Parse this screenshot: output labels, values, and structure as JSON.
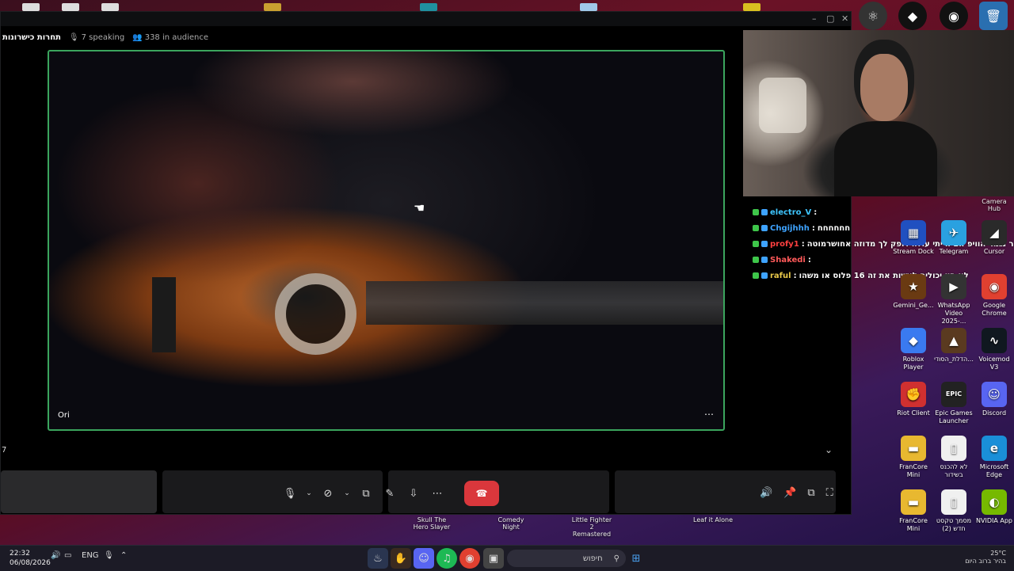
{
  "stage": {
    "title": "תחרות כישרונות",
    "speaking": "7 speaking",
    "audience": "338 in audience",
    "participant_name": "Ori",
    "participant_count": "7"
  },
  "chat": [
    {
      "user": "electro_V",
      "sep": ":",
      "msg": "",
      "color": "#3ec6ff"
    },
    {
      "user": "Chgijhhh",
      "sep": ":",
      "msg": "חחחחחח",
      "color": "#3ea3ff"
    },
    {
      "user": "profy1",
      "sep": ":",
      "msg": "ר נגמר הוויפ אם הייתי עולה דופק לך מדוזה אחושרמוטה",
      "color": "#ff4040"
    },
    {
      "user": "Shakedi",
      "sep": ":",
      "msg": "",
      "color": "#ff5a5a"
    },
    {
      "user": "raful",
      "sep": ":",
      "msg": "לא היו יכולים לעשות את זה 16 פלוס או משהו",
      "color": "#e8c84a"
    }
  ],
  "desktop_icons": [
    {
      "label": "Stream Dock",
      "glyph": "▦",
      "bg": "#2050c0"
    },
    {
      "label": "Telegram",
      "glyph": "✈",
      "bg": "#2aa1e0"
    },
    {
      "label": "Cursor",
      "glyph": "◢",
      "bg": "#2a2a2a"
    },
    {
      "label": "Gemini_Ge...",
      "glyph": "★",
      "bg": "#6a3a12"
    },
    {
      "label": "WhatsApp Video 2025-...",
      "glyph": "▶",
      "bg": "#333"
    },
    {
      "label": "Google Chrome",
      "glyph": "◉",
      "bg": "#e04030"
    },
    {
      "label": "Roblox Player",
      "glyph": "◆",
      "bg": "#3a7af0"
    },
    {
      "label": "הדלת_הסודי...",
      "glyph": "▲",
      "bg": "#5a3a20"
    },
    {
      "label": "Voicemod V3",
      "glyph": "∿",
      "bg": "#101820"
    },
    {
      "label": "Riot Client",
      "glyph": "✊",
      "bg": "#d03030"
    },
    {
      "label": "Epic Games Launcher",
      "glyph": "EPIC",
      "bg": "#222"
    },
    {
      "label": "Discord",
      "glyph": "☺",
      "bg": "#5865f2"
    },
    {
      "label": "FranCore Mini",
      "glyph": "▬",
      "bg": "#e8b830"
    },
    {
      "label": "לא להכנס בשידור",
      "glyph": "▯",
      "bg": "#f0f0f0"
    },
    {
      "label": "Microsoft Edge",
      "glyph": "e",
      "bg": "#1a8fd8"
    },
    {
      "label": "FranCore Mini",
      "glyph": "▬",
      "bg": "#e8b830"
    },
    {
      "label": "מסמך טקסט חדש (2)",
      "glyph": "▯",
      "bg": "#f0f0f0"
    },
    {
      "label": "NVIDIA App",
      "glyph": "◐",
      "bg": "#76b900"
    }
  ],
  "cam_labels": [
    "Camera Hub"
  ],
  "desktop_bottom_labels": [
    {
      "label": "Skull The Hero Slayer"
    },
    {
      "label": "Comedy Night"
    },
    {
      "label": "Little Fighter 2 Remastered"
    },
    {
      "label": "Leaf it Alone"
    }
  ],
  "taskbar": {
    "time": "22:32",
    "date": "06/08/2026",
    "lang": "ENG",
    "search_placeholder": "חיפוש",
    "weather_temp": "25°C",
    "weather_desc": "בהיר ברוב היום"
  }
}
